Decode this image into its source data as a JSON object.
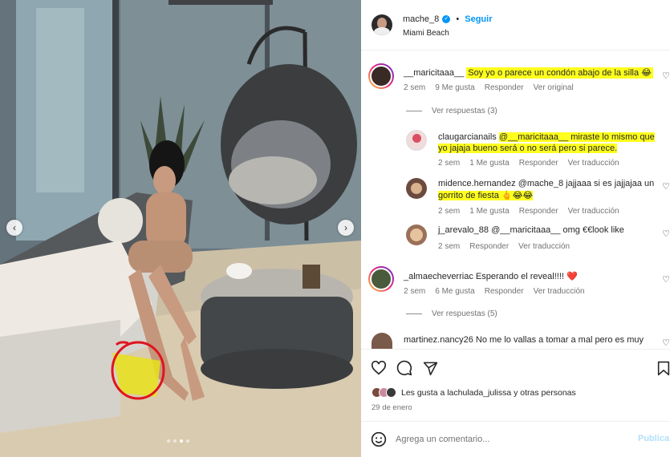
{
  "post": {
    "username": "mache_8",
    "follow_label": "Seguir",
    "location": "Miami Beach"
  },
  "comments": [
    {
      "username": "__maricitaaa__",
      "text": "Soy yo o parece un condón abajo de la silla 😂",
      "time": "2 sem",
      "likes": "9 Me gusta",
      "reply": "Responder",
      "translate": "Ver original",
      "view_replies": "Ver respuestas (3)"
    },
    {
      "username": "claugarcianails",
      "text_line1": "@__maricitaaa__ miraste lo mismo que",
      "text_line2": "yo jajaja bueno será o no será pero si parece.",
      "time": "2 sem",
      "likes": "1 Me gusta",
      "reply": "Responder",
      "translate": "Ver traducción"
    },
    {
      "username": "midence.hernandez",
      "text_line1": "@mache_8 jajjaaa si es jajjajaa un",
      "text_line2": "gorrito de fiesta 🖕😂😂",
      "time": "2 sem",
      "likes": "1 Me gusta",
      "reply": "Responder",
      "translate": "Ver traducción"
    },
    {
      "username": "j_arevalo_88",
      "text": "@__maricitaaa__ omg €€look like",
      "time": "2 sem",
      "reply": "Responder",
      "translate": "Ver traducción"
    },
    {
      "username": "_almaecheverriac",
      "text": "Esperando el reveal!!!! ❤️",
      "time": "2 sem",
      "likes": "6 Me gusta",
      "reply": "Responder",
      "translate": "Ver traducción",
      "view_replies": "Ver respuestas (5)"
    },
    {
      "username": "martinez.nancy26",
      "text": "No me lo vallas a tomar a mal pero es muy"
    }
  ],
  "likes_text": {
    "prefix": "Les gusta a ",
    "user": "lachulada_julissa",
    "middle": " y ",
    "others": "otras personas"
  },
  "date": "29 de enero",
  "add_comment": {
    "placeholder": "Agrega un comentario...",
    "publish": "Publicar"
  },
  "colors": {
    "accent": "#0095f6",
    "highlight": "#ffff1e",
    "annotation_red": "#e0141e"
  },
  "icons": [
    "verified-badge-icon",
    "heart-icon",
    "comment-icon",
    "share-icon",
    "bookmark-icon",
    "emoji-icon",
    "chevron-left-icon",
    "chevron-right-icon"
  ]
}
